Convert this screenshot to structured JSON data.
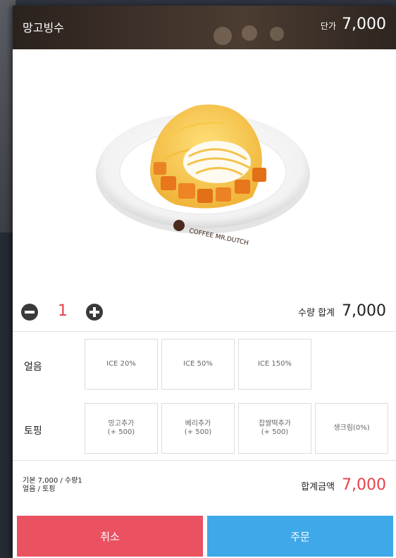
{
  "header": {
    "title": "망고빙수",
    "unit_price_label": "단가",
    "unit_price_value": "7,000"
  },
  "product": {
    "image_name": "mango-bingsu-photo",
    "plate_text": "COFFEE MR.DUTCH"
  },
  "quantity": {
    "value": "1",
    "total_label": "수량 합계",
    "total_value": "7,000"
  },
  "ice": {
    "label": "얼음",
    "options": [
      "ICE 20%",
      "ICE 50%",
      "ICE 150%"
    ]
  },
  "topping": {
    "label": "토핑",
    "options": [
      "망고추가\n(+ 500)",
      "베리추가\n(+ 500)",
      "찹쌀떡추가\n(+ 500)",
      "생크림(0%)"
    ]
  },
  "summary": {
    "line1": "기본 7,000 / 수량1",
    "line2": "얼음 / 토핑",
    "total_label": "합계금액",
    "total_value": "7,000"
  },
  "buttons": {
    "cancel": "취소",
    "order": "주문"
  },
  "colors": {
    "accent_red": "#e8414a",
    "cancel_bg": "#ea5161",
    "order_bg": "#3ea8e8"
  }
}
